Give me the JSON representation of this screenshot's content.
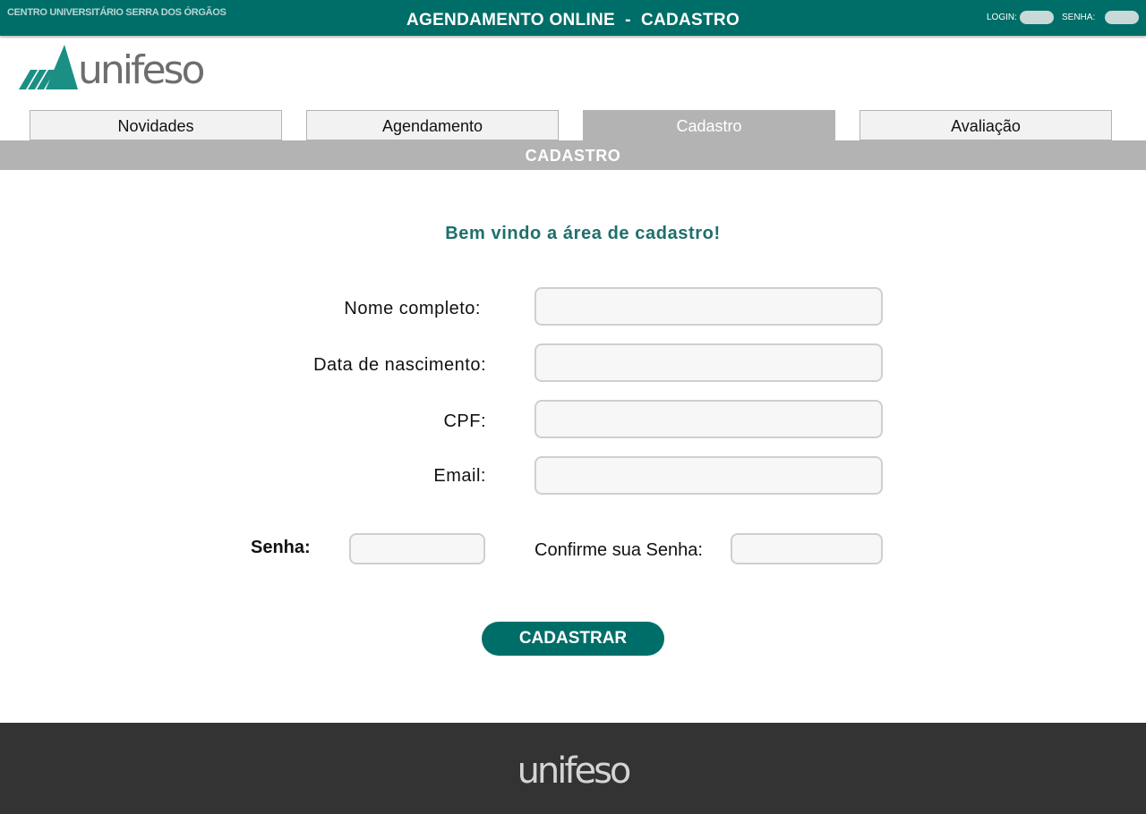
{
  "header": {
    "org_name": "CENTRO UNIVERSITÁRIO SERRA DOS ÓRGÃOS",
    "title": "AGENDAMENTO ONLINE  -  CADASTRO",
    "login_label": "LOGIN:",
    "senha_label": "SENHA:"
  },
  "logo": {
    "text": "unifeso"
  },
  "nav": {
    "tabs": [
      {
        "label": "Novidades",
        "active": false
      },
      {
        "label": "Agendamento",
        "active": false
      },
      {
        "label": "Cadastro",
        "active": true
      },
      {
        "label": "Avaliação",
        "active": false
      }
    ]
  },
  "section": {
    "title": "CADASTRO"
  },
  "form": {
    "welcome": "Bem vindo a área de cadastro!",
    "fields": [
      {
        "label": "Nome completo:",
        "value": ""
      },
      {
        "label": "Data de nascimento:",
        "value": ""
      },
      {
        "label": "CPF:",
        "value": ""
      },
      {
        "label": "Email:",
        "value": ""
      }
    ],
    "senha_label": "Senha:",
    "confirm_label": "Confirme sua Senha:",
    "submit_label": "CADASTRAR"
  },
  "footer": {
    "logo_text": "unifeso"
  },
  "colors": {
    "primary": "#006e68",
    "accent_text": "#1f6f6b",
    "tab_active": "#b3b3b3",
    "footer_bg": "#333333"
  }
}
